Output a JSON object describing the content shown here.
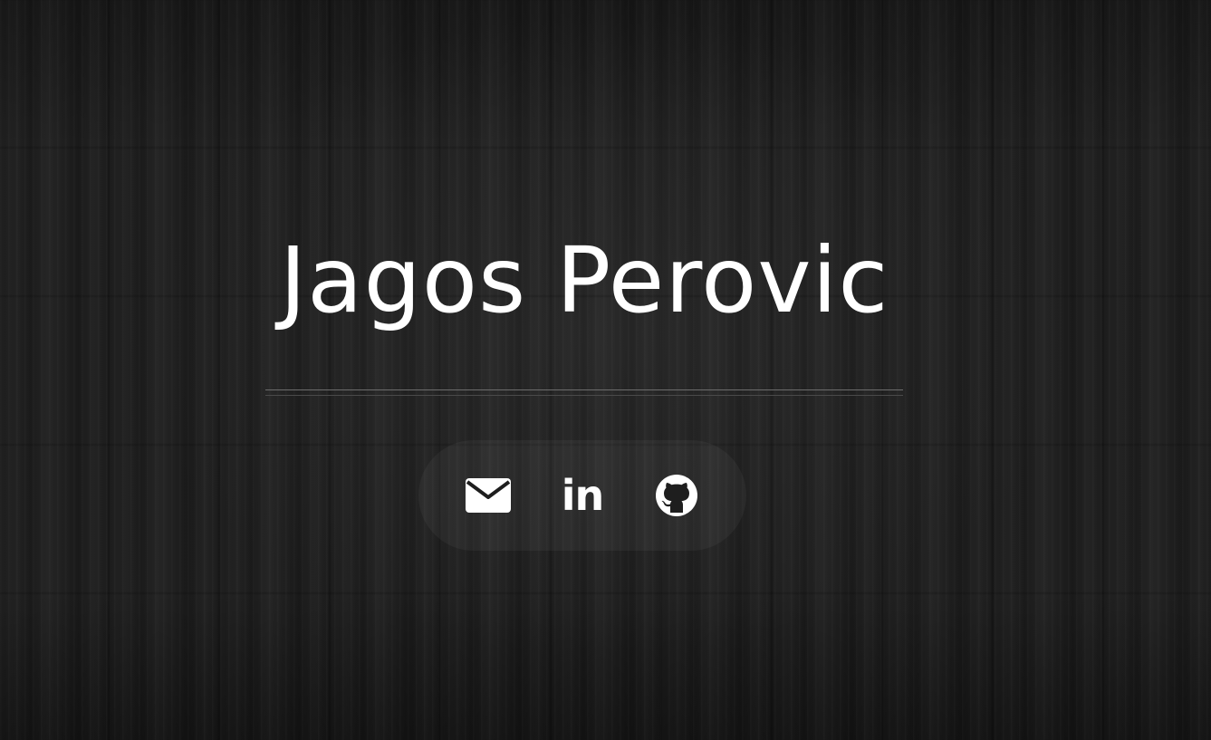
{
  "header": {
    "name": "Jagos Perovic"
  },
  "social": {
    "links": [
      {
        "icon": "envelope-icon",
        "label": "Email"
      },
      {
        "icon": "linkedin-icon",
        "label": "in"
      },
      {
        "icon": "github-icon",
        "label": "GitHub"
      }
    ]
  },
  "colors": {
    "background": "#1c1c1c",
    "text": "#ffffff",
    "divider": "#6d6d6d"
  }
}
